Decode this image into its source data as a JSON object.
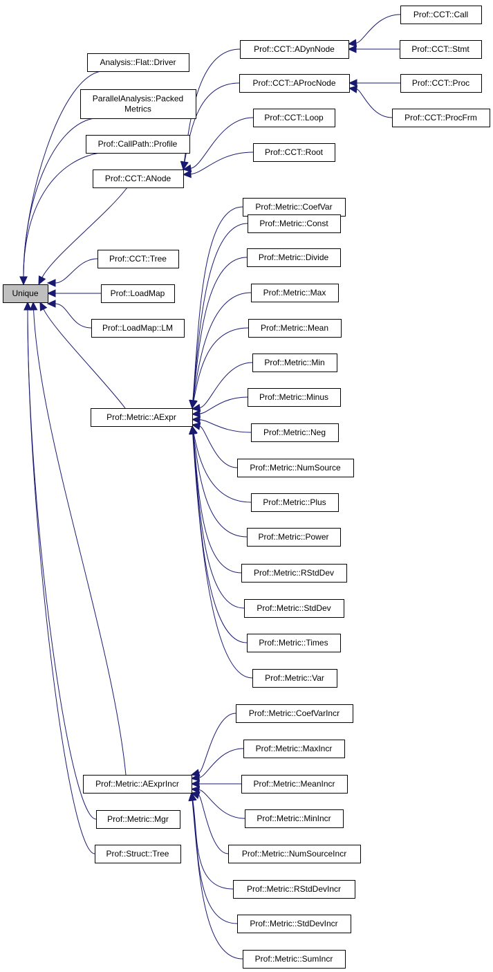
{
  "diagram": {
    "type": "inheritance-graph",
    "root": "Unique",
    "nodes": [
      {
        "id": "unique",
        "label": [
          "Unique"
        ],
        "root": true
      },
      {
        "id": "flatdriver",
        "label": [
          "Analysis::Flat::Driver"
        ]
      },
      {
        "id": "packed",
        "label": [
          "ParallelAnalysis::Packed",
          "Metrics"
        ]
      },
      {
        "id": "profile",
        "label": [
          "Prof::CallPath::Profile"
        ]
      },
      {
        "id": "anode",
        "label": [
          "Prof::CCT::ANode"
        ]
      },
      {
        "id": "ccttree",
        "label": [
          "Prof::CCT::Tree"
        ]
      },
      {
        "id": "loadmap",
        "label": [
          "Prof::LoadMap"
        ]
      },
      {
        "id": "lm",
        "label": [
          "Prof::LoadMap::LM"
        ]
      },
      {
        "id": "aexpr",
        "label": [
          "Prof::Metric::AExpr"
        ]
      },
      {
        "id": "aexprincr",
        "label": [
          "Prof::Metric::AExprIncr"
        ]
      },
      {
        "id": "mgr",
        "label": [
          "Prof::Metric::Mgr"
        ]
      },
      {
        "id": "structtree",
        "label": [
          "Prof::Struct::Tree"
        ]
      },
      {
        "id": "adyn",
        "label": [
          "Prof::CCT::ADynNode"
        ]
      },
      {
        "id": "aproc",
        "label": [
          "Prof::CCT::AProcNode"
        ]
      },
      {
        "id": "loop",
        "label": [
          "Prof::CCT::Loop"
        ]
      },
      {
        "id": "cctroot",
        "label": [
          "Prof::CCT::Root"
        ]
      },
      {
        "id": "call",
        "label": [
          "Prof::CCT::Call"
        ]
      },
      {
        "id": "stmt",
        "label": [
          "Prof::CCT::Stmt"
        ]
      },
      {
        "id": "proc",
        "label": [
          "Prof::CCT::Proc"
        ]
      },
      {
        "id": "procfrm",
        "label": [
          "Prof::CCT::ProcFrm"
        ]
      },
      {
        "id": "coefvar",
        "label": [
          "Prof::Metric::CoefVar"
        ]
      },
      {
        "id": "const",
        "label": [
          "Prof::Metric::Const"
        ]
      },
      {
        "id": "divide",
        "label": [
          "Prof::Metric::Divide"
        ]
      },
      {
        "id": "max",
        "label": [
          "Prof::Metric::Max"
        ]
      },
      {
        "id": "mean",
        "label": [
          "Prof::Metric::Mean"
        ]
      },
      {
        "id": "min",
        "label": [
          "Prof::Metric::Min"
        ]
      },
      {
        "id": "minus",
        "label": [
          "Prof::Metric::Minus"
        ]
      },
      {
        "id": "neg",
        "label": [
          "Prof::Metric::Neg"
        ]
      },
      {
        "id": "numsource",
        "label": [
          "Prof::Metric::NumSource"
        ]
      },
      {
        "id": "plus",
        "label": [
          "Prof::Metric::Plus"
        ]
      },
      {
        "id": "power",
        "label": [
          "Prof::Metric::Power"
        ]
      },
      {
        "id": "rstddev",
        "label": [
          "Prof::Metric::RStdDev"
        ]
      },
      {
        "id": "stddev",
        "label": [
          "Prof::Metric::StdDev"
        ]
      },
      {
        "id": "times",
        "label": [
          "Prof::Metric::Times"
        ]
      },
      {
        "id": "var",
        "label": [
          "Prof::Metric::Var"
        ]
      },
      {
        "id": "coefvarincr",
        "label": [
          "Prof::Metric::CoefVarIncr"
        ]
      },
      {
        "id": "maxincr",
        "label": [
          "Prof::Metric::MaxIncr"
        ]
      },
      {
        "id": "meanincr",
        "label": [
          "Prof::Metric::MeanIncr"
        ]
      },
      {
        "id": "minincr",
        "label": [
          "Prof::Metric::MinIncr"
        ]
      },
      {
        "id": "numsourceincr",
        "label": [
          "Prof::Metric::NumSourceIncr"
        ]
      },
      {
        "id": "rstddevincr",
        "label": [
          "Prof::Metric::RStdDevIncr"
        ]
      },
      {
        "id": "stddevincr",
        "label": [
          "Prof::Metric::StdDevIncr"
        ]
      },
      {
        "id": "sumincr",
        "label": [
          "Prof::Metric::SumIncr"
        ]
      }
    ],
    "edges": [
      [
        "flatdriver",
        "unique"
      ],
      [
        "packed",
        "unique"
      ],
      [
        "profile",
        "unique"
      ],
      [
        "anode",
        "unique"
      ],
      [
        "ccttree",
        "unique"
      ],
      [
        "loadmap",
        "unique"
      ],
      [
        "lm",
        "unique"
      ],
      [
        "aexpr",
        "unique"
      ],
      [
        "aexprincr",
        "unique"
      ],
      [
        "mgr",
        "unique"
      ],
      [
        "structtree",
        "unique"
      ],
      [
        "adyn",
        "anode"
      ],
      [
        "aproc",
        "anode"
      ],
      [
        "loop",
        "anode"
      ],
      [
        "cctroot",
        "anode"
      ],
      [
        "call",
        "adyn"
      ],
      [
        "stmt",
        "adyn"
      ],
      [
        "proc",
        "aproc"
      ],
      [
        "procfrm",
        "aproc"
      ],
      [
        "coefvar",
        "aexpr"
      ],
      [
        "const",
        "aexpr"
      ],
      [
        "divide",
        "aexpr"
      ],
      [
        "max",
        "aexpr"
      ],
      [
        "mean",
        "aexpr"
      ],
      [
        "min",
        "aexpr"
      ],
      [
        "minus",
        "aexpr"
      ],
      [
        "neg",
        "aexpr"
      ],
      [
        "numsource",
        "aexpr"
      ],
      [
        "plus",
        "aexpr"
      ],
      [
        "power",
        "aexpr"
      ],
      [
        "rstddev",
        "aexpr"
      ],
      [
        "stddev",
        "aexpr"
      ],
      [
        "times",
        "aexpr"
      ],
      [
        "var",
        "aexpr"
      ],
      [
        "coefvarincr",
        "aexprincr"
      ],
      [
        "maxincr",
        "aexprincr"
      ],
      [
        "meanincr",
        "aexprincr"
      ],
      [
        "minincr",
        "aexprincr"
      ],
      [
        "numsourceincr",
        "aexprincr"
      ],
      [
        "rstddevincr",
        "aexprincr"
      ],
      [
        "stddevincr",
        "aexprincr"
      ],
      [
        "sumincr",
        "aexprincr"
      ]
    ]
  }
}
